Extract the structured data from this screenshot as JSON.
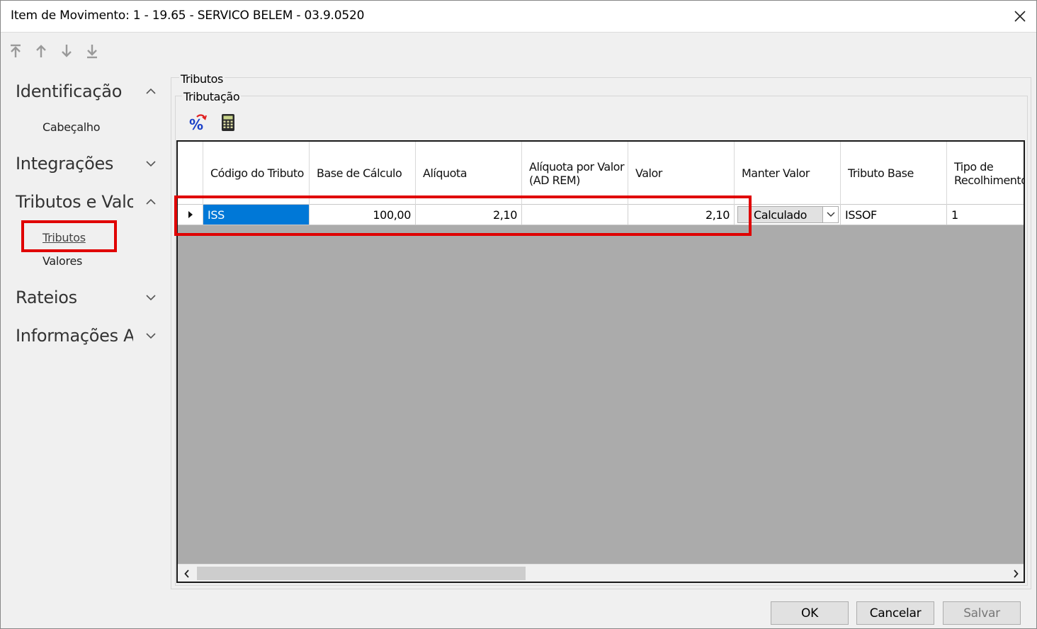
{
  "window": {
    "title": "Item de Movimento: 1 - 19.65 - SERVICO BELEM - 03.9.0520"
  },
  "nav_toolbar": {
    "icons": [
      "first-record-icon",
      "previous-record-icon",
      "next-record-icon",
      "last-record-icon"
    ]
  },
  "sidebar": {
    "sections": [
      {
        "label": "Identificação",
        "expanded": true,
        "items": [
          "Cabeçalho"
        ]
      },
      {
        "label": "Integrações",
        "expanded": false,
        "items": []
      },
      {
        "label": "Tributos e Valo",
        "expanded": true,
        "items": [
          "Tributos",
          "Valores"
        ]
      },
      {
        "label": "Rateios",
        "expanded": false,
        "items": []
      },
      {
        "label": "Informações Ac",
        "expanded": false,
        "items": []
      }
    ],
    "active_item": "Tributos"
  },
  "panel": {
    "outer_group": "Tributos",
    "inner_group": "Tributação",
    "toolbar_icons": [
      "percent-recalc-icon",
      "calculator-icon"
    ]
  },
  "grid": {
    "columns": [
      "Código do Tributo",
      "Base de Cálculo",
      "Alíquota",
      "Alíquota por Valor (AD REM)",
      "Valor",
      "Manter Valor",
      "Tributo Base",
      "Tipo de Recolhimento"
    ],
    "rows": [
      {
        "codigo": "ISS",
        "base": "100,00",
        "aliquota": "2,10",
        "aliquota_valor": "",
        "valor": "2,10",
        "manter_valor": "Calculado",
        "tributo_base": "ISSOF",
        "tipo_recolhimento": "1"
      }
    ]
  },
  "buttons": {
    "ok": "OK",
    "cancel": "Cancelar",
    "save": "Salvar"
  },
  "colors": {
    "highlight_box": "#e00000",
    "selection": "#0078d7",
    "grid_empty": "#ababab"
  }
}
